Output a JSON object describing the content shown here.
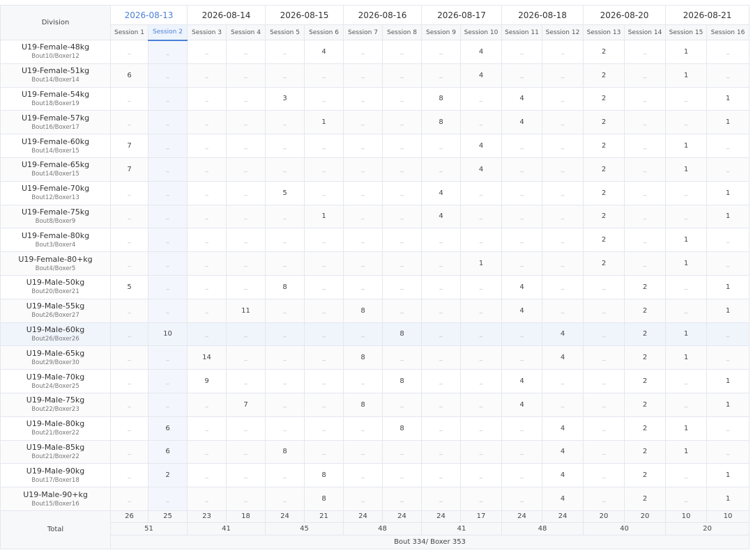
{
  "header": {
    "division_label": "Division",
    "dates": [
      {
        "label": "2026-08-13",
        "sessions": 2,
        "active": true
      },
      {
        "label": "2026-08-14",
        "sessions": 2,
        "active": false
      },
      {
        "label": "2026-08-15",
        "sessions": 2,
        "active": false
      },
      {
        "label": "2026-08-16",
        "sessions": 2,
        "active": false
      },
      {
        "label": "2026-08-17",
        "sessions": 2,
        "active": false
      },
      {
        "label": "2026-08-18",
        "sessions": 2,
        "active": false
      },
      {
        "label": "2026-08-20",
        "sessions": 2,
        "active": false
      },
      {
        "label": "2026-08-21",
        "sessions": 2,
        "active": false
      }
    ],
    "sessions": [
      "Session 1",
      "Session 2",
      "Session 3",
      "Session 4",
      "Session 5",
      "Session 6",
      "Session 7",
      "Session 8",
      "Session 9",
      "Session 10",
      "Session 11",
      "Session 12",
      "Session 13",
      "Session 14",
      "Session 15",
      "Session 16"
    ],
    "active_session_index": 1
  },
  "empty_marker": "_",
  "rows": [
    {
      "name": "U19-Female-48kg",
      "sub": "Bout10/Boxer12",
      "cells": [
        "",
        "",
        "",
        "",
        "",
        "4",
        "",
        "",
        "",
        "4",
        "",
        "",
        "2",
        "",
        "1",
        ""
      ]
    },
    {
      "name": "U19-Female-51kg",
      "sub": "Bout14/Boxer14",
      "cells": [
        "6",
        "",
        "",
        "",
        "",
        "",
        "",
        "",
        "",
        "4",
        "",
        "",
        "2",
        "",
        "1",
        ""
      ]
    },
    {
      "name": "U19-Female-54kg",
      "sub": "Bout18/Boxer19",
      "cells": [
        "",
        "",
        "",
        "",
        "3",
        "",
        "",
        "",
        "8",
        "",
        "4",
        "",
        "2",
        "",
        "",
        "1"
      ]
    },
    {
      "name": "U19-Female-57kg",
      "sub": "Bout16/Boxer17",
      "cells": [
        "",
        "",
        "",
        "",
        "",
        "1",
        "",
        "",
        "8",
        "",
        "4",
        "",
        "2",
        "",
        "",
        "1"
      ]
    },
    {
      "name": "U19-Female-60kg",
      "sub": "Bout14/Boxer15",
      "cells": [
        "7",
        "",
        "",
        "",
        "",
        "",
        "",
        "",
        "",
        "4",
        "",
        "",
        "2",
        "",
        "1",
        ""
      ]
    },
    {
      "name": "U19-Female-65kg",
      "sub": "Bout14/Boxer15",
      "cells": [
        "7",
        "",
        "",
        "",
        "",
        "",
        "",
        "",
        "",
        "4",
        "",
        "",
        "2",
        "",
        "1",
        ""
      ]
    },
    {
      "name": "U19-Female-70kg",
      "sub": "Bout12/Boxer13",
      "cells": [
        "",
        "",
        "",
        "",
        "5",
        "",
        "",
        "",
        "4",
        "",
        "",
        "",
        "2",
        "",
        "",
        "1"
      ]
    },
    {
      "name": "U19-Female-75kg",
      "sub": "Bout8/Boxer9",
      "cells": [
        "",
        "",
        "",
        "",
        "",
        "1",
        "",
        "",
        "4",
        "",
        "",
        "",
        "2",
        "",
        "",
        "1"
      ]
    },
    {
      "name": "U19-Female-80kg",
      "sub": "Bout3/Boxer4",
      "cells": [
        "",
        "",
        "",
        "",
        "",
        "",
        "",
        "",
        "",
        "",
        "",
        "",
        "2",
        "",
        "1",
        ""
      ]
    },
    {
      "name": "U19-Female-80+kg",
      "sub": "Bout4/Boxer5",
      "cells": [
        "",
        "",
        "",
        "",
        "",
        "",
        "",
        "",
        "",
        "1",
        "",
        "",
        "2",
        "",
        "1",
        ""
      ]
    },
    {
      "name": "U19-Male-50kg",
      "sub": "Bout20/Boxer21",
      "cells": [
        "5",
        "",
        "",
        "",
        "8",
        "",
        "",
        "",
        "",
        "",
        "4",
        "",
        "",
        "2",
        "",
        "1"
      ]
    },
    {
      "name": "U19-Male-55kg",
      "sub": "Bout26/Boxer27",
      "cells": [
        "",
        "",
        "",
        "11",
        "",
        "",
        "8",
        "",
        "",
        "",
        "4",
        "",
        "",
        "2",
        "",
        "1"
      ]
    },
    {
      "name": "U19-Male-60kg",
      "sub": "Bout26/Boxer26",
      "cells": [
        "",
        "10",
        "",
        "",
        "",
        "",
        "",
        "8",
        "",
        "",
        "",
        "4",
        "",
        "2",
        "1",
        ""
      ],
      "highlight": true
    },
    {
      "name": "U19-Male-65kg",
      "sub": "Bout29/Boxer30",
      "cells": [
        "",
        "",
        "14",
        "",
        "",
        "",
        "8",
        "",
        "",
        "",
        "",
        "4",
        "",
        "2",
        "1",
        ""
      ]
    },
    {
      "name": "U19-Male-70kg",
      "sub": "Bout24/Boxer25",
      "cells": [
        "",
        "",
        "9",
        "",
        "",
        "",
        "",
        "8",
        "",
        "",
        "4",
        "",
        "",
        "2",
        "",
        "1"
      ]
    },
    {
      "name": "U19-Male-75kg",
      "sub": "Bout22/Boxer23",
      "cells": [
        "",
        "",
        "",
        "7",
        "",
        "",
        "8",
        "",
        "",
        "",
        "4",
        "",
        "",
        "2",
        "",
        "1"
      ]
    },
    {
      "name": "U19-Male-80kg",
      "sub": "Bout21/Boxer22",
      "cells": [
        "",
        "6",
        "",
        "",
        "",
        "",
        "",
        "8",
        "",
        "",
        "",
        "4",
        "",
        "2",
        "1",
        ""
      ]
    },
    {
      "name": "U19-Male-85kg",
      "sub": "Bout21/Boxer22",
      "cells": [
        "",
        "6",
        "",
        "",
        "8",
        "",
        "",
        "",
        "",
        "",
        "",
        "4",
        "",
        "2",
        "1",
        ""
      ]
    },
    {
      "name": "U19-Male-90kg",
      "sub": "Bout17/Boxer18",
      "cells": [
        "",
        "2",
        "",
        "",
        "",
        "8",
        "",
        "",
        "",
        "",
        "",
        "4",
        "",
        "2",
        "",
        "1"
      ]
    },
    {
      "name": "U19-Male-90+kg",
      "sub": "Bout15/Boxer16",
      "cells": [
        "",
        "",
        "",
        "",
        "",
        "8",
        "",
        "",
        "",
        "",
        "",
        "4",
        "",
        "2",
        "",
        "1"
      ]
    }
  ],
  "totals": {
    "label": "Total",
    "sessions": [
      "26",
      "25",
      "23",
      "18",
      "24",
      "21",
      "24",
      "24",
      "24",
      "17",
      "24",
      "24",
      "20",
      "20",
      "10",
      "10"
    ],
    "dates": [
      "51",
      "41",
      "45",
      "48",
      "41",
      "48",
      "40",
      "20"
    ],
    "overall": "Bout 334/ Boxer 353"
  }
}
